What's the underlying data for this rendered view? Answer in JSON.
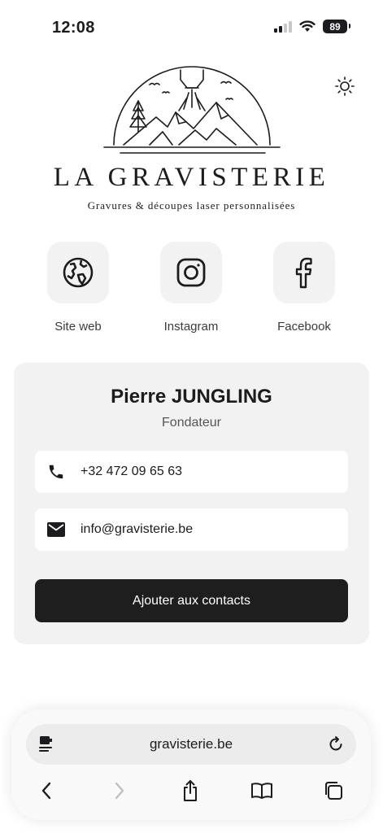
{
  "status_bar": {
    "time": "12:08",
    "battery": "89"
  },
  "brand": {
    "name": "LA GRAVISTERIE",
    "tagline": "Gravures & découpes laser personnalisées"
  },
  "socials": [
    {
      "label": "Site web",
      "icon": "globe-icon"
    },
    {
      "label": "Instagram",
      "icon": "instagram-icon"
    },
    {
      "label": "Facebook",
      "icon": "facebook-icon"
    }
  ],
  "card": {
    "name": "Pierre JUNGLING",
    "role": "Fondateur",
    "phone": "+32 472 09 65 63",
    "email": "info@gravisterie.be",
    "add_button": "Ajouter aux contacts"
  },
  "browser": {
    "url": "gravisterie.be",
    "icons": [
      "page-menu-icon",
      "reload-icon",
      "back-icon",
      "forward-icon",
      "share-icon",
      "bookmarks-icon",
      "tabs-icon"
    ]
  },
  "colors": {
    "card_bg": "#f2f2f2",
    "button_bg": "#1e1e1e",
    "social_bg": "#f2f2f3"
  }
}
